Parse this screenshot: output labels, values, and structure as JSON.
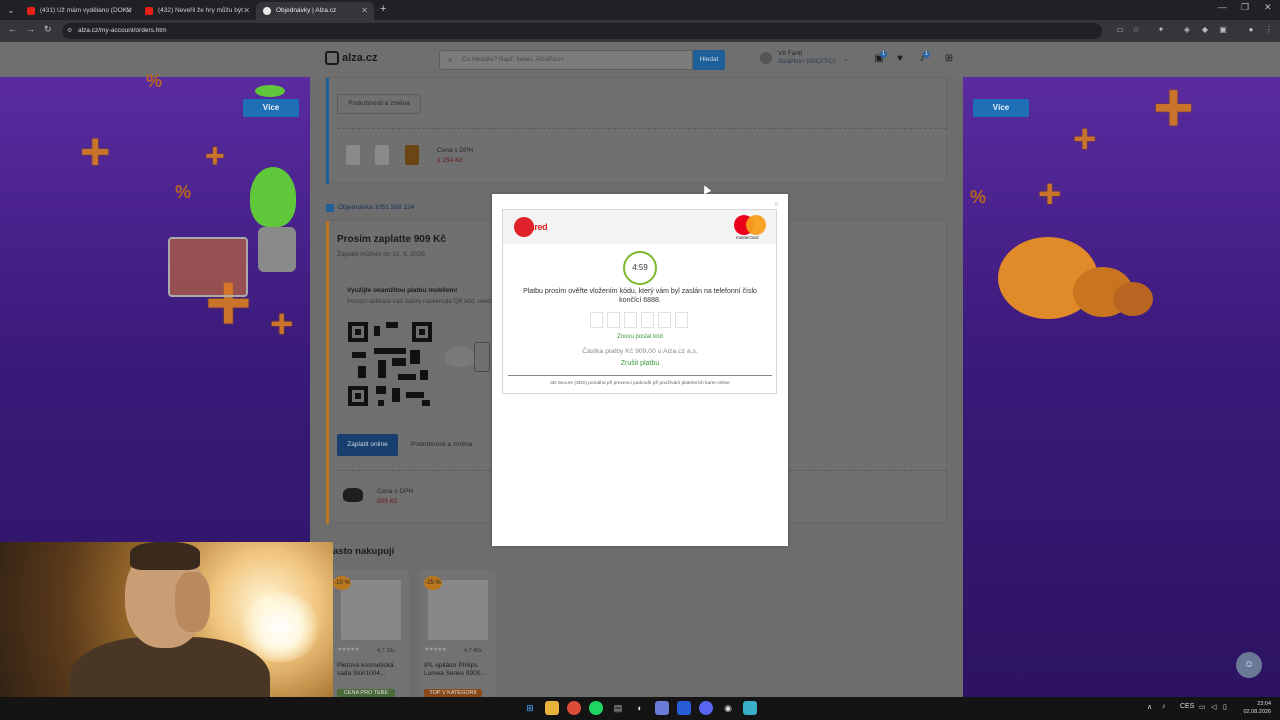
{
  "browser": {
    "tabs": [
      {
        "label": "(431) Už mám vydělano (DOKU",
        "icon": "youtube-icon",
        "active": false
      },
      {
        "label": "(432) Neveřil že hry můžu být",
        "icon": "youtube-icon",
        "active": false
      },
      {
        "label": "Objednávky | Alza.cz",
        "icon": "alza-icon",
        "active": true
      }
    ],
    "url": "alza.cz/my-account/orders.htm"
  },
  "header": {
    "logo": "alza.cz",
    "search_placeholder": "Co hledáte? Např. kabel, AlzaPlus+",
    "search_button": "Hledat",
    "user_name": "Vít Fanti",
    "user_sub": "AlzaPlus+ (ISIC/ITIC)",
    "badges": {
      "orders": "1",
      "notifications": "1"
    }
  },
  "side": {
    "left_button": "Více",
    "right_button": "Více"
  },
  "orders": {
    "prev_details": "Podrobnosti a změna",
    "prev_price_label": "Cena s DPH",
    "prev_price": "1 254 Kč",
    "order_number": "Objednávka 1051 588 134",
    "pay_title": "Prosím zaplatte 909 Kč",
    "pay_sub": "Zaplatit můžete do 10. 8. 2026",
    "mobile_title": "Využijte okamžitou platbu mobilem!",
    "mobile_desc": "Pomocí aplikace vaší banky naskenujte QR kód, uvedený",
    "pay_online": "Zaplatit online",
    "details": "Podrobnosti a změna",
    "price_label": "Cena s DPH",
    "price": "909 Kč"
  },
  "recommend": {
    "heading": "asto nakupují",
    "products": [
      {
        "discount": "-10 %",
        "rating": "4,7",
        "count": "29x",
        "title": "Pleťová kosmetická sada Skin1004...",
        "tag": "CENA PRO TEBE"
      },
      {
        "discount": "-25 %",
        "rating": "4,7",
        "count": "40x",
        "title": "IPL epilátor Philips Lumea Series 9900...",
        "tag": "TOP V KATEGORII"
      }
    ]
  },
  "modal": {
    "brand": "edenred",
    "card_network": "mastercard",
    "timer": "4:59",
    "verify_text": "Platbu prosím ověřte vložením kódu, který vám byl zaslán na telefonní číslo končící 6888.",
    "resend": "Znovu poslat kód",
    "amount": "Částka platby Kč 909,00 u Alza.cz a.s.",
    "cancel": "Zrušit platbu",
    "secure_note": "3D-Secure (3DS) pomáhá při prevenci podvodů při používání platebních karet online",
    "close": "×"
  },
  "taskbar": {
    "lang": "CES",
    "time": "23:04",
    "date": "02.08.2026"
  },
  "colors": {
    "accent_blue": "#1d5f96",
    "edenred_red": "#e0222b",
    "success_green": "#3c9a3c",
    "timer_ring": "#7cb82f",
    "side_purple": "#3a1a7a"
  }
}
